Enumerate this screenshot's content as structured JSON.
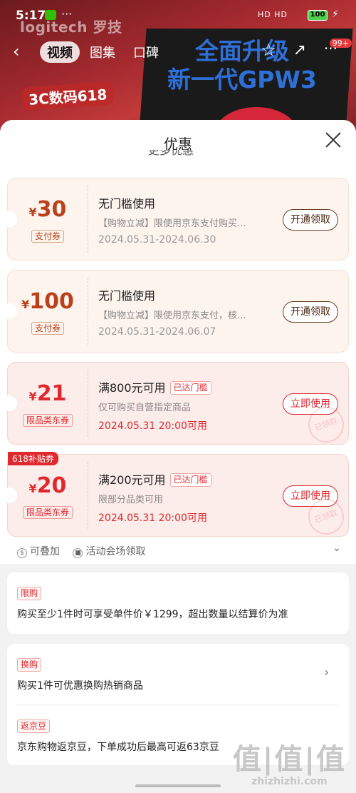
{
  "status_bar": {
    "time": "5:17",
    "signal": "HD HD",
    "battery": "100"
  },
  "background": {
    "brand": "logitech 罗技",
    "promo": "3C数码618",
    "headline_1": "全面升级",
    "headline_2": "新一代GPW3",
    "badge": "99+"
  },
  "nav": {
    "tabs": [
      "视频",
      "图集",
      "口碑"
    ],
    "active_tab": "视频"
  },
  "sheet": {
    "title": "优惠",
    "peek_text": "更多优惠"
  },
  "coupons": [
    {
      "symbol": "¥",
      "amount": "30",
      "tag": "支付券",
      "title": "无门槛使用",
      "desc": "【购物立减】限使用京东支付购买...",
      "date": "2024.05.31-2024.06.30",
      "button": "开通领取",
      "style": "light"
    },
    {
      "symbol": "¥",
      "amount": "100",
      "tag": "支付券",
      "title": "无门槛使用",
      "desc": "【购物立减】限使用京东支付，核...",
      "date": "2024.05.31-2024.06.07",
      "button": "开通领取",
      "style": "light"
    },
    {
      "symbol": "¥",
      "amount": "21",
      "tag": "限品类东券",
      "title": "满800元可用",
      "reached": "已达门槛",
      "desc": "仅可购买自营指定商品",
      "date": "2024.05.31 20:00可用",
      "button": "立即使用",
      "style": "pink",
      "stamp": "已领取"
    },
    {
      "symbol": "¥",
      "amount": "20",
      "tag": "限品类东券",
      "title": "满200元可用",
      "reached": "已达门槛",
      "desc": "限部分品类可用",
      "date": "2024.05.31 20:00可用",
      "button": "立即使用",
      "style": "pink",
      "stamp": "已领取",
      "corner": "618补贴券"
    }
  ],
  "coupon_footer": {
    "stackable": "可叠加",
    "venue": "活动会场领取"
  },
  "limit_card": {
    "tag": "限购",
    "text": "购买至少1件时可享受单件价￥1299，超出数量以结算价为准"
  },
  "exchange_card": {
    "tag": "换购",
    "text": "购买1件可优惠换购热销商品",
    "bean_tag": "返京豆",
    "bean_text": "京东购物返京豆，下单成功后最高可返63京豆"
  },
  "watermark": {
    "big": "值|值|值",
    "small": "zhizhizhi.com"
  },
  "colors": {
    "accent_red": "#e0292f",
    "coupon_brown": "#b9411c"
  }
}
